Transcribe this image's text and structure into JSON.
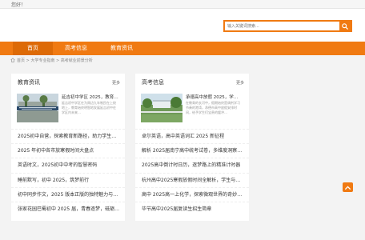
{
  "topbar": {
    "greeting": "您好！"
  },
  "search": {
    "placeholder": "输入关键词搜索..."
  },
  "nav": {
    "items": [
      {
        "label": "首页"
      },
      {
        "label": "高考信息"
      },
      {
        "label": "教育资讯"
      }
    ]
  },
  "breadcrumb": {
    "text": "首页 > 大学专业指南 > 高考就业前景分析"
  },
  "panels": [
    {
      "title": "教育资讯",
      "more": "更多",
      "featured": {
        "title": "延吉初中学区 2025，教育…",
        "summary": "延吉初中学区在为周边九年制民在上校地上，教育始终明智地发展延吉初中在学区内未来…"
      },
      "items": [
        "2025初中自营，探索教育新路径，助力学生全面发展",
        "2025 年初中各市放寒假时间大盘点",
        "英语时文，2025初中中考的智慧密码",
        "睡前默写，初中 2025，筑梦前行",
        "初中同步作文，2025 版本正版的独特魅力与价值",
        "张家花园巴蜀初中 2025 届，青春逐梦，砥砺前行"
      ]
    },
    {
      "title": "高考信息",
      "more": "更多",
      "featured": {
        "title": "承德高中放假 2025，学…",
        "summary": "在教育的长河中，假期始终是调剂学习节奏的港湾，承德市高中放假安排时间，给予学生们宝贵的缓冲…"
      },
      "items": [
        "卓尔英语，高中英语词汇 2025 新征程",
        "解析 2025届南宁高中统考试卷，多维度洞察与备考启示",
        "2025高中倒计时日历，逐梦路上的精准计时器",
        "杭州高中2025寒假放假时间全解析，学生与家长必看",
        "高中 2025高一上化学，探索微观世界的奇妙之旅",
        "毕节高中2025届复读生招生简章"
      ]
    }
  ],
  "colors": {
    "accent": "#f07a12",
    "accent_dark": "#dd6a06",
    "page_bg": "#f3f3f3"
  },
  "icons": {
    "search": "search-icon",
    "home": "home-icon",
    "to_top": "chevron-up-icon"
  }
}
